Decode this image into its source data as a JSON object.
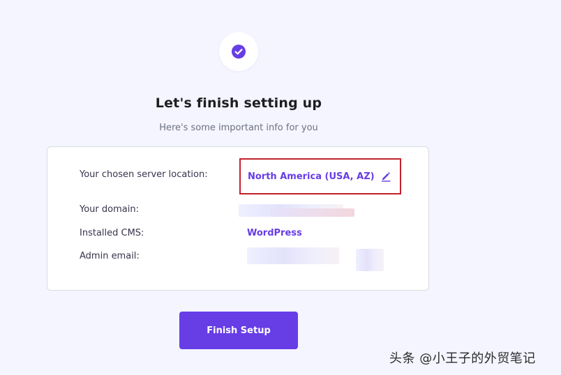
{
  "header": {
    "title": "Let's finish setting up",
    "subtitle": "Here's some important info for you"
  },
  "info": {
    "server_location": {
      "label": "Your chosen server location:",
      "value": "North America (USA, AZ)"
    },
    "domain": {
      "label": "Your domain:"
    },
    "cms": {
      "label": "Installed CMS:",
      "value": "WordPress"
    },
    "admin_email": {
      "label": "Admin email:"
    }
  },
  "actions": {
    "finish_label": "Finish Setup"
  },
  "watermark": "头条 @小王子的外贸笔记",
  "colors": {
    "accent": "#673de6",
    "highlight": "#c3202b",
    "background": "#f4f5ff"
  },
  "icons": {
    "status": "check-circle-icon",
    "edit": "pencil-icon"
  }
}
